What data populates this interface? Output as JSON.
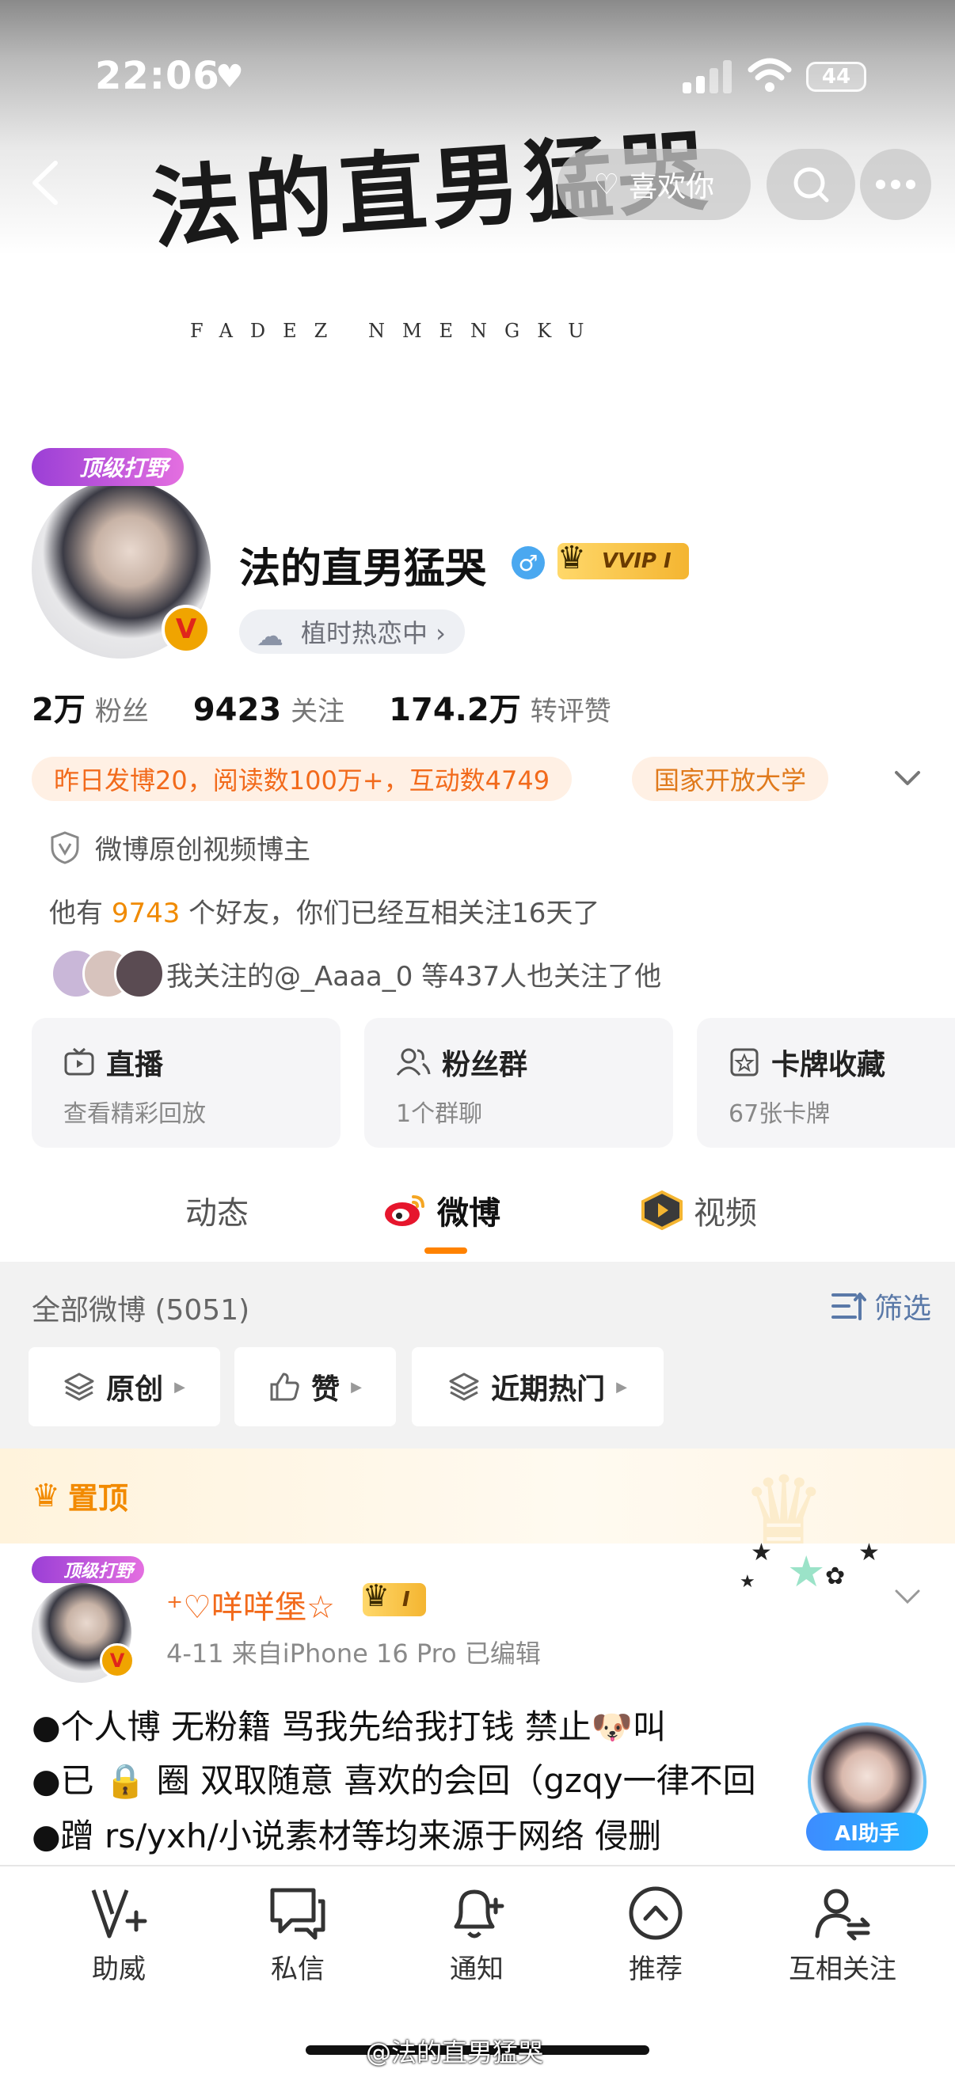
{
  "status_bar": {
    "time": "22:06",
    "battery": "44"
  },
  "header": {
    "like_label": "喜欢你",
    "banner_calligraphy": "法的直男猛哭",
    "banner_pinyin": "FADEZ NMENGKU"
  },
  "profile": {
    "top_badge": "顶级打野",
    "username": "法的直男猛哭",
    "gender": "♂",
    "vip": "VVIP I",
    "topic": "植时热恋中 ›",
    "stats": [
      {
        "value": "2万",
        "label": "粉丝"
      },
      {
        "value": "9423",
        "label": "关注"
      },
      {
        "value": "174.2万",
        "label": "转评赞"
      }
    ],
    "tag_activity": "昨日发博20，阅读数100万+，互动数4749",
    "tag_school": "国家开放大学",
    "verified": "微博原创视频博主",
    "friends_prefix": "他有",
    "friends_count": "9743",
    "friends_suffix": "个好友，你们已经互相关注16天了",
    "mutual_follow": "我关注的@_Aaaa_0 等437人也关注了他"
  },
  "cards": [
    {
      "title": "直播",
      "sub": "查看精彩回放"
    },
    {
      "title": "粉丝群",
      "sub": "1个群聊"
    },
    {
      "title": "卡牌收藏",
      "sub": "67张卡牌"
    }
  ],
  "tabs": [
    {
      "label": "动态"
    },
    {
      "label": "微博"
    },
    {
      "label": "视频"
    }
  ],
  "filter": {
    "title": "全部微博 (5051)",
    "button": "筛选",
    "chips": [
      "原创",
      "赞",
      "近期热门"
    ]
  },
  "pinned": {
    "label": "置顶"
  },
  "post": {
    "badge": "顶级打野",
    "author": "⁺♡咩咩堡☆",
    "vip": "I",
    "meta": "4-11  来自iPhone 16 Pro  已编辑",
    "lines": [
      "●个人博 无粉籍 骂我先给我打钱 禁止🐶叫",
      "●已 🔒 圈 双取随意 喜欢的会回（gzqy一律不回",
      "●蹭 rs/yxh/小说素材等均来源于网络 侵删"
    ]
  },
  "ai_assistant": {
    "label": "AI助手"
  },
  "bottom_nav": [
    {
      "label": "助威",
      "icon": "cheer-icon"
    },
    {
      "label": "私信",
      "icon": "message-icon"
    },
    {
      "label": "通知",
      "icon": "bell-icon"
    },
    {
      "label": "推荐",
      "icon": "recommend-icon"
    },
    {
      "label": "互相关注",
      "icon": "mutual-follow-icon"
    }
  ],
  "watermark": "@法的直男猛哭",
  "colors": {
    "accent": "#ff8200",
    "orange_text": "#f26a1b",
    "link_blue": "#5a79a8"
  }
}
